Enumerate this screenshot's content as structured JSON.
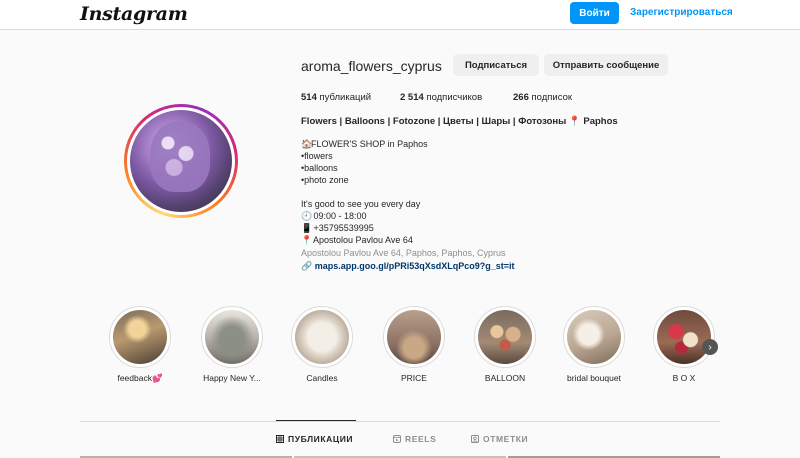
{
  "header": {
    "logo": "Instagram",
    "login_label": "Войти",
    "register_label": "Зарегистрироваться"
  },
  "profile": {
    "username": "aroma_flowers_cyprus",
    "follow_label": "Подписаться",
    "message_label": "Отправить сообщение",
    "stats": {
      "posts_count": "514",
      "posts_label": " публикаций",
      "followers_count": "2 514",
      "followers_label": " подписчиков",
      "following_count": "266",
      "following_label": " подписок"
    },
    "bio_name": "Flowers | Balloons | Fotozone | Цветы | Шары | Фотозоны ",
    "bio_name_suffix": " Paphos",
    "bio_lines": [
      "FLOWER'S SHOP in Paphos",
      "•flowers",
      "•balloons",
      "•photo zone",
      "It's good to see you every day",
      " 09:00 - 18:00",
      " +35795539995",
      " Apostolou Pavlou Ave 64"
    ],
    "address": "Apostolou Pavlou Ave 64, Paphos, Paphos, Cyprus",
    "link": "maps.app.goo.gl/pPRi53qXsdXLqPco9?g_st=it"
  },
  "highlights": [
    {
      "label": "feedback💕",
      "image_icon": "feedback-photo"
    },
    {
      "label": "Happy New Y...",
      "image_icon": "christmas-tree-photo"
    },
    {
      "label": "Candles",
      "image_icon": "candle-photo"
    },
    {
      "label": "PRICE",
      "image_icon": "price-photo"
    },
    {
      "label": "BALLOON",
      "image_icon": "balloon-photo"
    },
    {
      "label": "bridal bouquet",
      "image_icon": "bouquet-photo"
    },
    {
      "label": "B O X",
      "image_icon": "flower-box-photo"
    }
  ],
  "tabs": [
    {
      "label": "ПУБЛИКАЦИИ",
      "icon": "grid-icon",
      "active": true
    },
    {
      "label": "REELS",
      "icon": "reels-icon",
      "active": false
    },
    {
      "label": "ОТМЕТКИ",
      "icon": "tagged-icon",
      "active": false
    }
  ],
  "colors": {
    "accent": "#0095f6",
    "text": "#262626",
    "muted": "#8e8e8e",
    "link": "#00376b"
  }
}
